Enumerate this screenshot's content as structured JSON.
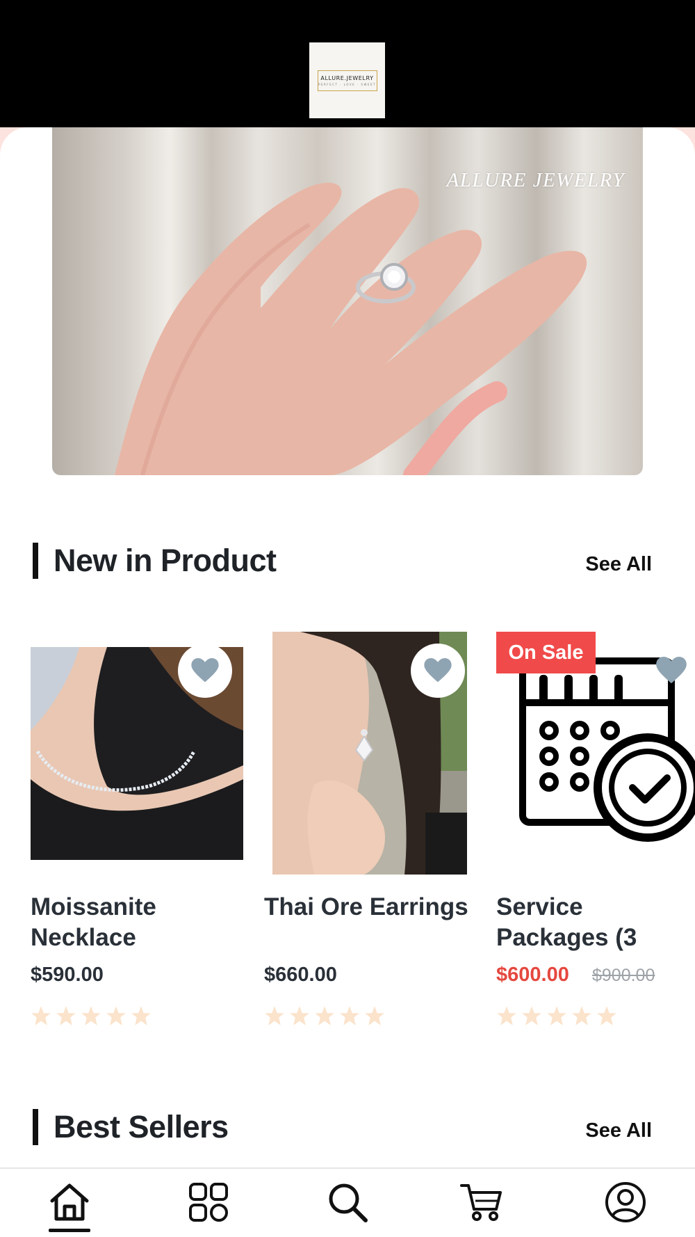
{
  "header": {
    "logo_title": "ALLURE.JEWELRY",
    "logo_tagline": "PERFECT · LOVE · SWEET"
  },
  "banner": {
    "overlay_text": "ALLURE JEWELRY",
    "image_description": "hand wearing a silver solitaire ring"
  },
  "new_in": {
    "title": "New in Product",
    "see_all": "See All",
    "products": [
      {
        "name": "Moissanite Necklace",
        "price": "$590.00",
        "image": "necklace-photo",
        "rating": 5,
        "on_sale": false
      },
      {
        "name": "Thai Ore Earrings",
        "price": "$660.00",
        "image": "earrings-photo",
        "rating": 5,
        "on_sale": false
      },
      {
        "name": "Service Packages (3",
        "price": "$600.00",
        "old_price": "$900.00",
        "image": "calendar-clock-icon",
        "rating": 5,
        "on_sale": true,
        "badge": "On Sale"
      }
    ]
  },
  "best_sellers": {
    "title": "Best Sellers",
    "see_all": "See All"
  },
  "bottom_nav": {
    "items": [
      "home-icon",
      "categories-icon",
      "search-icon",
      "cart-icon",
      "profile-icon"
    ],
    "active": "home-icon"
  },
  "colors": {
    "accent_sale": "#e5483f",
    "badge_bg": "#f14a4a",
    "heart": "#8fa4b3",
    "star": "#fbe3cc",
    "header_bg": "#000000"
  }
}
